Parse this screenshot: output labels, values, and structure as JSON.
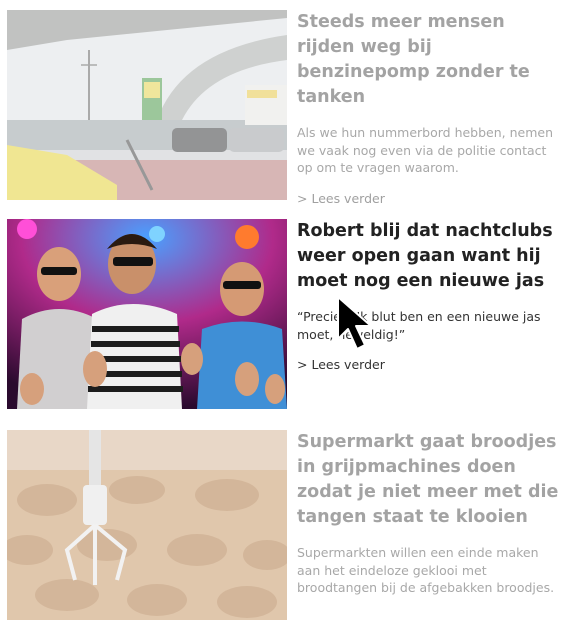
{
  "articles": [
    {
      "title": "Steeds meer mensen rijden weg bij benzinepomp zonder te tanken",
      "description": "Als we hun nummerbord hebben, nemen we vaak nog even via de politie contact op om te vragen waarom.",
      "read_more": "> Lees verder"
    },
    {
      "title": "Robert blij dat nachtclubs weer open gaan want hij moet nog een nieuwe jas",
      "description": "“Precies! Ik blut ben en een nieuwe jas moet, heweldig!”",
      "read_more": "> Lees verder"
    },
    {
      "title": "Supermarkt gaat broodjes in grijpmachines doen zodat je niet meer met die tangen staat te klooien",
      "description": "Supermarkten willen een einde maken aan het eindeloze geklooi met broodtangen bij de afgebakken broodjes.",
      "read_more": ""
    }
  ],
  "cursor": "arrow-pointer-icon"
}
